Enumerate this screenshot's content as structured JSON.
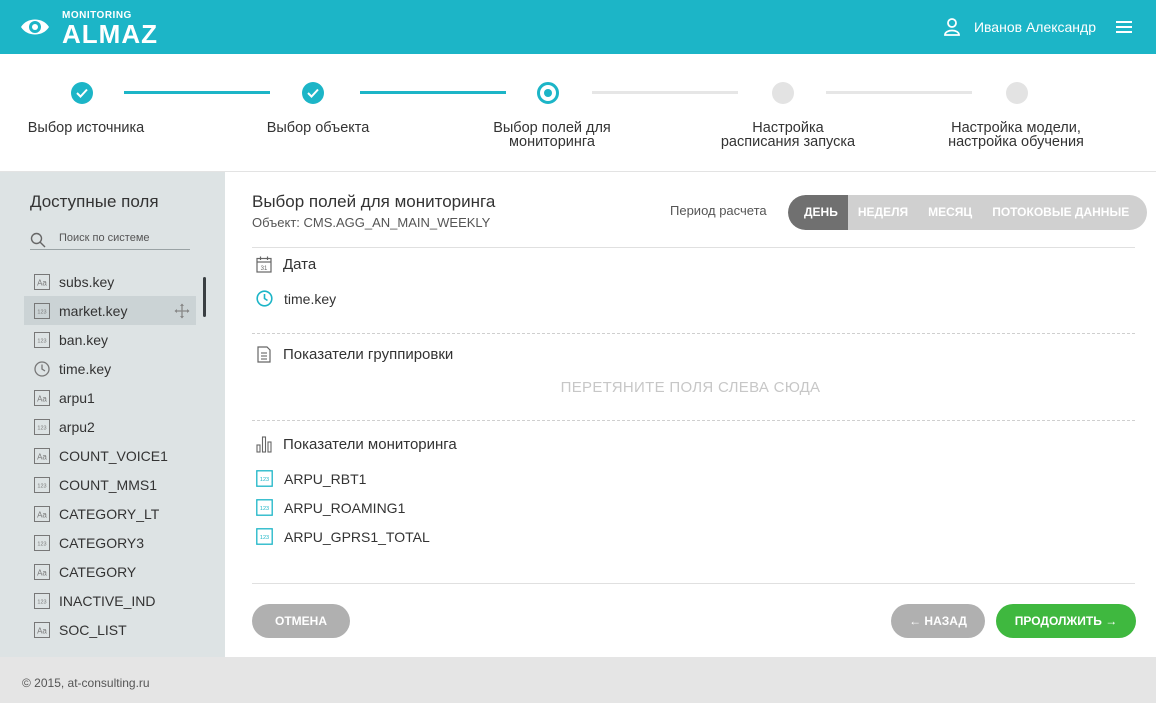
{
  "header": {
    "logo_small": "MONITORING",
    "logo_big": "ALMAZ",
    "user_name": "Иванов Александр",
    "accent": "#1cb5c7"
  },
  "stepper": {
    "steps": [
      {
        "label": "Выбор источника",
        "state": "done"
      },
      {
        "label": "Выбор объекта",
        "state": "done"
      },
      {
        "label": "Выбор полей для\nмониторинга",
        "state": "active"
      },
      {
        "label": "Настройка\nрасписания запуска",
        "state": "pending"
      },
      {
        "label": "Настройка модели,\nнастройка обучения",
        "state": "pending"
      }
    ]
  },
  "sidebar": {
    "title": "Доступные поля",
    "search_placeholder": "Поиск по системе",
    "items": [
      {
        "label": "subs.key",
        "icon": "text-type-icon"
      },
      {
        "label": "market.key",
        "icon": "number-type-icon"
      },
      {
        "label": "ban.key",
        "icon": "number-type-icon"
      },
      {
        "label": "time.key",
        "icon": "clock-icon"
      },
      {
        "label": "arpu1",
        "icon": "text-type-icon"
      },
      {
        "label": "arpu2",
        "icon": "number-type-icon"
      },
      {
        "label": "COUNT_VOICE1",
        "icon": "text-type-icon"
      },
      {
        "label": "COUNT_MMS1",
        "icon": "number-type-icon"
      },
      {
        "label": "CATEGORY_LT",
        "icon": "text-type-icon"
      },
      {
        "label": "CATEGORY3",
        "icon": "number-type-icon"
      },
      {
        "label": "CATEGORY",
        "icon": "text-type-icon"
      },
      {
        "label": "INACTIVE_IND",
        "icon": "number-type-icon"
      },
      {
        "label": "SOC_LIST",
        "icon": "text-type-icon"
      }
    ]
  },
  "main": {
    "title": "Выбор полей для мониторинга",
    "subtitle": "Объект: CMS.AGG_AN_MAIN_WEEKLY",
    "period_label": "Период расчета",
    "periods": [
      "ДЕНЬ",
      "НЕДЕЛЯ",
      "МЕСЯЦ",
      "ПОТОКОВЫЕ ДАННЫЕ"
    ],
    "selected_period": "ДЕНЬ",
    "date_section": {
      "title": "Дата",
      "fields": [
        "time.key"
      ]
    },
    "grouping_section": {
      "title": "Показатели группировки",
      "drop_hint": "ПЕРЕТЯНИТЕ ПОЛЯ СЛЕВА СЮДА"
    },
    "monitoring_section": {
      "title": "Показатели мониторинга",
      "fields": [
        "ARPU_RBT1",
        "ARPU_ROAMING1",
        "ARPU_GPRS1_TOTAL"
      ]
    },
    "cancel_label": "ОТМЕНА",
    "back_label": "← НАЗАД",
    "next_label": "ПРОДОЛЖИТЬ →"
  },
  "footer": {
    "text": "© 2015, at-consulting.ru"
  }
}
